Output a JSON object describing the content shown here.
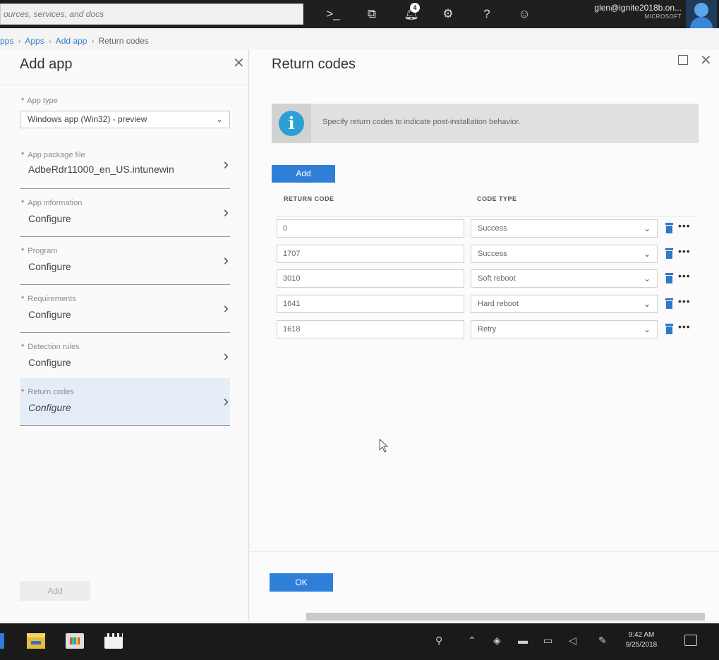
{
  "topbar": {
    "search_placeholder": "ources, services, and docs",
    "notification_count": "4",
    "account_email": "glen@ignite2018b.on...",
    "account_tenant": "MICROSOFT"
  },
  "breadcrumb": {
    "items": [
      "pps",
      "Apps",
      "Add app",
      "Return codes"
    ]
  },
  "add_app_blade": {
    "title": "Add app",
    "app_type_label": "App type",
    "app_type_value": "Windows app (Win32) - preview",
    "steps": [
      {
        "label": "App package file",
        "value": "AdbeRdr11000_en_US.intunewin"
      },
      {
        "label": "App information",
        "value": "Configure"
      },
      {
        "label": "Program",
        "value": "Configure"
      },
      {
        "label": "Requirements",
        "value": "Configure"
      },
      {
        "label": "Detection rules",
        "value": "Configure"
      },
      {
        "label": "Return codes",
        "value": "Configure"
      }
    ],
    "add_label": "Add"
  },
  "return_codes_blade": {
    "title": "Return codes",
    "info_text": "Specify return codes to indicate post-installation behavior.",
    "add_label": "Add",
    "col_return_code": "RETURN CODE",
    "col_code_type": "CODE TYPE",
    "rows": [
      {
        "code": "0",
        "type": "Success"
      },
      {
        "code": "1707",
        "type": "Success"
      },
      {
        "code": "3010",
        "type": "Soft reboot"
      },
      {
        "code": "1641",
        "type": "Hard reboot"
      },
      {
        "code": "1618",
        "type": "Retry"
      }
    ],
    "ok_label": "OK"
  },
  "taskbar": {
    "time": "9:42 AM",
    "date": "9/25/2018"
  },
  "colors": {
    "accent": "#2f7fd9",
    "topbar": "#1f1f1f",
    "active_step": "#e5eef8"
  }
}
